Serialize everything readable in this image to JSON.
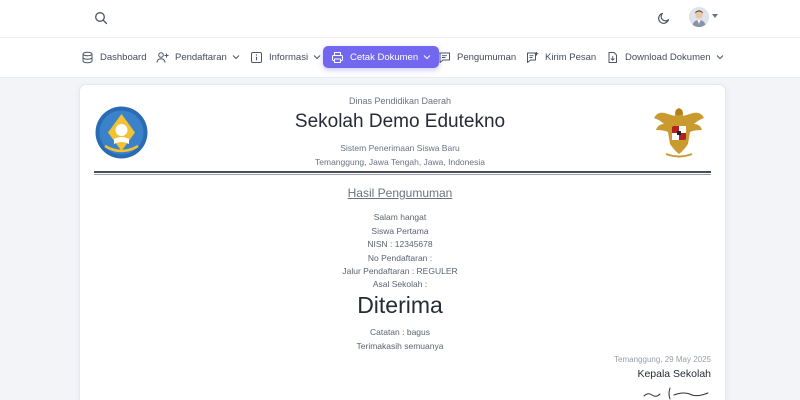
{
  "topbar": {
    "search_icon": "search-icon",
    "theme_icon": "moon-icon",
    "avatar_icon": "user-avatar"
  },
  "nav": {
    "items": [
      {
        "label": "Dashboard",
        "icon": "database-icon",
        "dropdown": false
      },
      {
        "label": "Pendaftaran",
        "icon": "user-plus-icon",
        "dropdown": true
      },
      {
        "label": "Informasi",
        "icon": "info-icon",
        "dropdown": true
      },
      {
        "label": "Cetak Dokumen",
        "icon": "printer-icon",
        "dropdown": true,
        "active": true
      },
      {
        "label": "Pengumuman",
        "icon": "message-icon",
        "dropdown": false
      },
      {
        "label": "Kirim Pesan",
        "icon": "send-message-icon",
        "dropdown": false
      },
      {
        "label": "Download Dokumen",
        "icon": "file-download-icon",
        "dropdown": true
      }
    ],
    "accent_color": "#7367f0"
  },
  "letter": {
    "department": "Dinas Pendidikan Daerah",
    "school_name": "Sekolah Demo Edutekno",
    "system_name": "Sistem Penerimaan Siswa Baru",
    "address": "Temanggung, Jawa Tengah, Jawa, Indonesia",
    "logo_left": "tut-wuri-handayani-logo",
    "logo_right": "garuda-pancasila-emblem",
    "heading": "Hasil Pengumuman",
    "greeting": "Salam hangat",
    "student_name": "Siswa Pertama",
    "nisn": "NISN : 12345678",
    "registration_no": "No Pendaftaran :",
    "admission_path": "Jalur Pendaftaran : REGULER",
    "origin_school": "Asal Sekolah :",
    "result": "Diterima",
    "note": "Catatan : bagus",
    "closing": "Terimakasih semuanya",
    "date_place": "Temanggung, 29 May 2025",
    "signer_title": "Kepala Sekolah"
  }
}
